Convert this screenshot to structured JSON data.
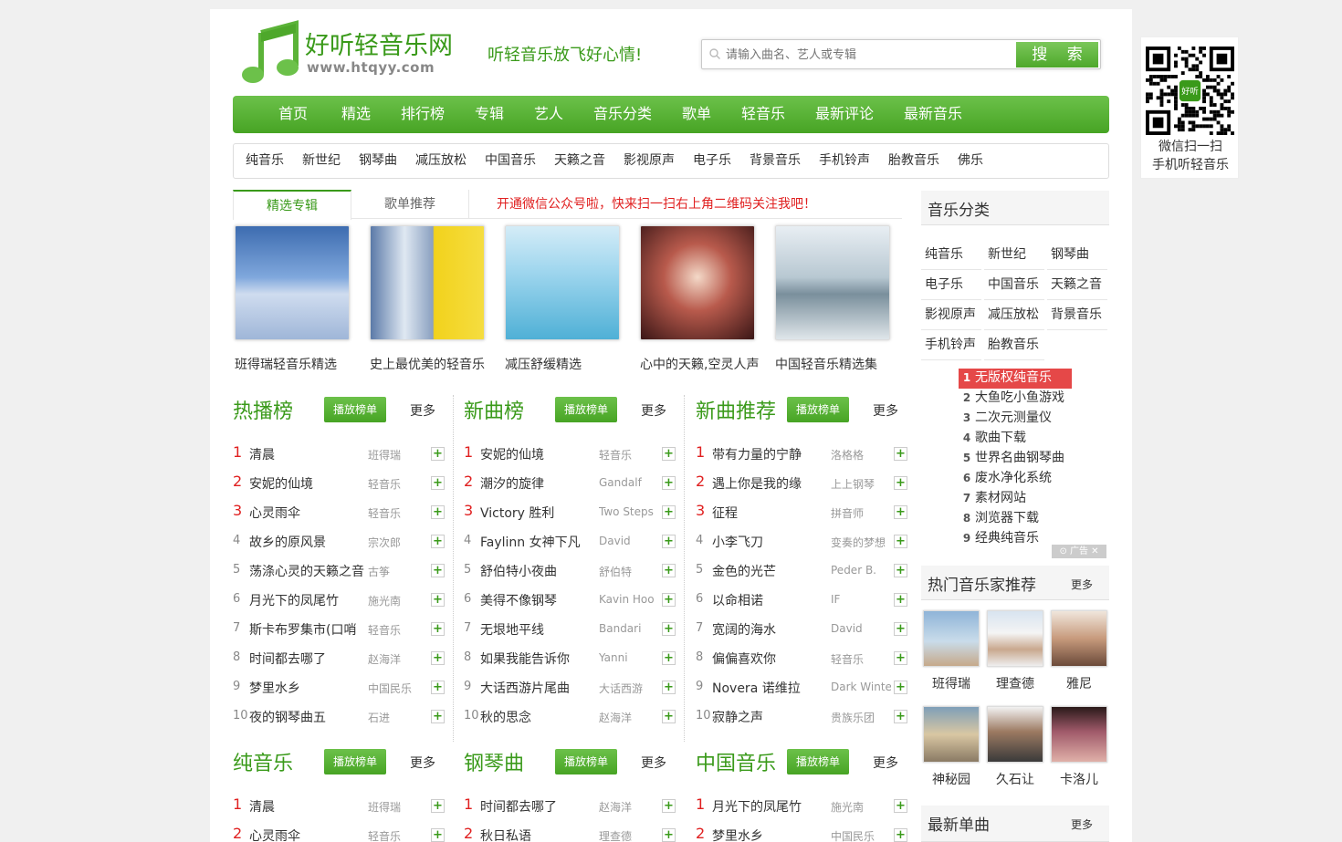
{
  "header": {
    "site_name": "好听轻音乐网",
    "site_url": "www.htqyy.com",
    "slogan": "听轻音乐放飞好心情!",
    "search_placeholder": "请输入曲名、艺人或专辑",
    "search_button": "搜 索"
  },
  "nav": [
    "首页",
    "精选",
    "排行榜",
    "专辑",
    "艺人",
    "音乐分类",
    "歌单",
    "轻音乐",
    "最新评论",
    "最新音乐"
  ],
  "subnav": [
    "纯音乐",
    "新世纪",
    "钢琴曲",
    "减压放松",
    "中国音乐",
    "天籁之音",
    "影视原声",
    "电子乐",
    "背景音乐",
    "手机铃声",
    "胎教音乐",
    "佛乐"
  ],
  "tabs": {
    "active": "精选专辑",
    "other": "歌单推荐",
    "notice": "开通微信公众号啦，快来扫一扫右上角二维码关注我吧！"
  },
  "albums": [
    "班得瑞轻音乐精选",
    "史上最优美的轻音乐",
    "减压舒缓精选",
    "心中的天籁,空灵人声",
    "中国轻音乐精选集"
  ],
  "panels": [
    {
      "title": "热播榜",
      "play": "播放榜单",
      "more": "更多",
      "rows": [
        [
          "1",
          "清晨",
          "班得瑞"
        ],
        [
          "2",
          "安妮的仙境",
          "轻音乐"
        ],
        [
          "3",
          "心灵雨伞",
          "轻音乐"
        ],
        [
          "4",
          "故乡的原风景",
          "宗次郎"
        ],
        [
          "5",
          "荡涤心灵的天籁之音",
          "古筝"
        ],
        [
          "6",
          "月光下的凤尾竹",
          "施光南"
        ],
        [
          "7",
          "斯卡布罗集市(口哨",
          "轻音乐"
        ],
        [
          "8",
          "时间都去哪了",
          "赵海洋"
        ],
        [
          "9",
          "梦里水乡",
          "中国民乐"
        ],
        [
          "10",
          "夜的钢琴曲五",
          "石进"
        ]
      ]
    },
    {
      "title": "新曲榜",
      "play": "播放榜单",
      "more": "更多",
      "rows": [
        [
          "1",
          "安妮的仙境",
          "轻音乐"
        ],
        [
          "2",
          "潮汐的旋律",
          "Gandalf"
        ],
        [
          "3",
          "Victory 胜利",
          "Two Steps"
        ],
        [
          "4",
          "Faylinn 女神下凡",
          "David"
        ],
        [
          "5",
          "舒伯特小夜曲",
          "舒伯特"
        ],
        [
          "6",
          "美得不像钢琴",
          "Kavin Hoo"
        ],
        [
          "7",
          "无垠地平线",
          "Bandari"
        ],
        [
          "8",
          "如果我能告诉你",
          "Yanni"
        ],
        [
          "9",
          "大话西游片尾曲",
          "大话西游"
        ],
        [
          "10",
          "秋的思念",
          "赵海洋"
        ]
      ]
    },
    {
      "title": "新曲推荐",
      "play": "播放榜单",
      "more": "更多",
      "rows": [
        [
          "1",
          "带有力量的宁静",
          "洛格格"
        ],
        [
          "2",
          "遇上你是我的缘",
          "上上钢琴"
        ],
        [
          "3",
          "征程",
          "拼音师"
        ],
        [
          "4",
          "小李飞刀",
          "变奏的梦想"
        ],
        [
          "5",
          "金色的光芒",
          "Peder B."
        ],
        [
          "6",
          "以命相诺",
          "IF"
        ],
        [
          "7",
          "宽阔的海水",
          "David"
        ],
        [
          "8",
          "偏偏喜欢你",
          "轻音乐"
        ],
        [
          "9",
          "Novera 诺维拉",
          "Dark Winter"
        ],
        [
          "10",
          "寂静之声",
          "贵族乐团"
        ]
      ]
    },
    {
      "title": "纯音乐",
      "play": "播放榜单",
      "more": "更多",
      "rows": [
        [
          "1",
          "清晨",
          "班得瑞"
        ],
        [
          "2",
          "心灵雨伞",
          "轻音乐"
        ]
      ]
    },
    {
      "title": "钢琴曲",
      "play": "播放榜单",
      "more": "更多",
      "rows": [
        [
          "1",
          "时间都去哪了",
          "赵海洋"
        ],
        [
          "2",
          "秋日私语",
          "理查德"
        ]
      ]
    },
    {
      "title": "中国音乐",
      "play": "播放榜单",
      "more": "更多",
      "rows": [
        [
          "1",
          "月光下的凤尾竹",
          "施光南"
        ],
        [
          "2",
          "梦里水乡",
          "中国民乐"
        ]
      ]
    }
  ],
  "side": {
    "category_title": "音乐分类",
    "categories": [
      "纯音乐",
      "新世纪",
      "钢琴曲",
      "电子乐",
      "中国音乐",
      "天籁之音",
      "影视原声",
      "减压放松",
      "背景音乐",
      "手机铃声",
      "胎教音乐"
    ],
    "ads": [
      [
        "1",
        "无版权纯音乐"
      ],
      [
        "2",
        "大鱼吃小鱼游戏"
      ],
      [
        "3",
        "二次元测量仪"
      ],
      [
        "4",
        "歌曲下载"
      ],
      [
        "5",
        "世界名曲钢琴曲"
      ],
      [
        "6",
        "废水净化系统"
      ],
      [
        "7",
        "素材网站"
      ],
      [
        "8",
        "浏览器下载"
      ],
      [
        "9",
        "经典纯音乐"
      ]
    ],
    "ad_tag": "广告",
    "artists_title": "热门音乐家推荐",
    "artists_more": "更多",
    "artists": [
      "班得瑞",
      "理查德",
      "雅尼",
      "神秘园",
      "久石让",
      "卡洛儿"
    ],
    "latest_title": "最新单曲",
    "latest_more": "更多"
  },
  "qr": {
    "line1": "微信扫一扫",
    "line2": "手机听轻音乐",
    "badge": "好听"
  },
  "colors": {
    "brand": "#3a9a1a",
    "nav_green": "#5bb338",
    "rank_red": "#e02020",
    "ad_red": "#e54848"
  }
}
